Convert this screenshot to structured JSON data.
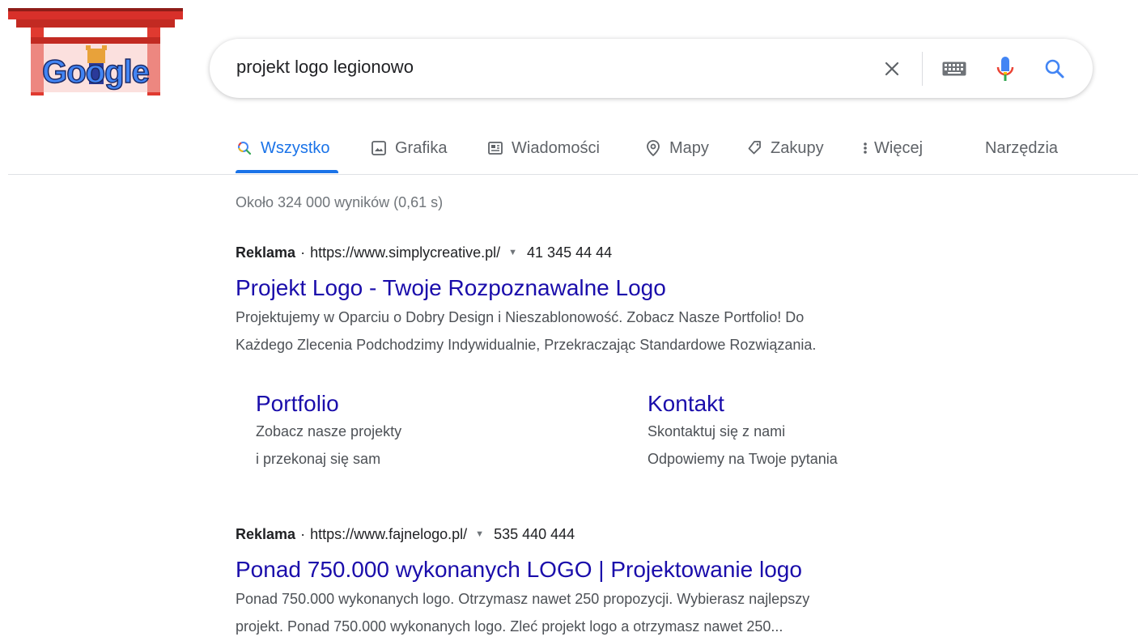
{
  "search": {
    "query": "projekt logo legionowo"
  },
  "tabs": [
    {
      "label": "Wszystko",
      "icon": "search-icon",
      "active": true
    },
    {
      "label": "Grafika",
      "icon": "image-icon"
    },
    {
      "label": "Wiadomości",
      "icon": "news-icon"
    },
    {
      "label": "Mapy",
      "icon": "map-pin-icon"
    },
    {
      "label": "Zakupy",
      "icon": "tag-icon"
    },
    {
      "label": "Więcej",
      "icon": "more-vert-icon"
    }
  ],
  "tools_label": "Narzędzia",
  "stats": "Około 324 000 wyników (0,61 s)",
  "ads": [
    {
      "badge": "Reklama",
      "url": "https://www.simplycreative.pl/",
      "phone": "41 345 44 44",
      "title": "Projekt Logo - Twoje Rozpoznawalne Logo",
      "desc_line1": "Projektujemy w Oparciu o Dobry Design i Nieszablonowość. Zobacz Nasze Portfolio! Do",
      "desc_line2": "Każdego Zlecenia Podchodzimy Indywidualnie, Przekraczając Standardowe Rozwiązania.",
      "sitelinks": [
        {
          "title": "Portfolio",
          "line1": "Zobacz nasze projekty",
          "line2": "i przekonaj się sam"
        },
        {
          "title": "Kontakt",
          "line1": "Skontaktuj się z nami",
          "line2": "Odpowiemy na Twoje pytania"
        }
      ]
    },
    {
      "badge": "Reklama",
      "url": "https://www.fajnelogo.pl/",
      "phone": "535 440 444",
      "title": "Ponad 750.000 wykonanych LOGO | Projektowanie logo",
      "desc_line1": "Ponad 750.000 wykonanych logo. Otrzymasz nawet 250 propozycji. Wybierasz najlepszy",
      "desc_line2": "projekt. Ponad 750.000 wykonanych logo. Zleć projekt logo a otrzymasz nawet 250..."
    }
  ],
  "logo": {
    "text": "Google"
  },
  "colors": {
    "link": "#1a0dab",
    "accent": "#1a73e8",
    "muted": "#70757a"
  }
}
